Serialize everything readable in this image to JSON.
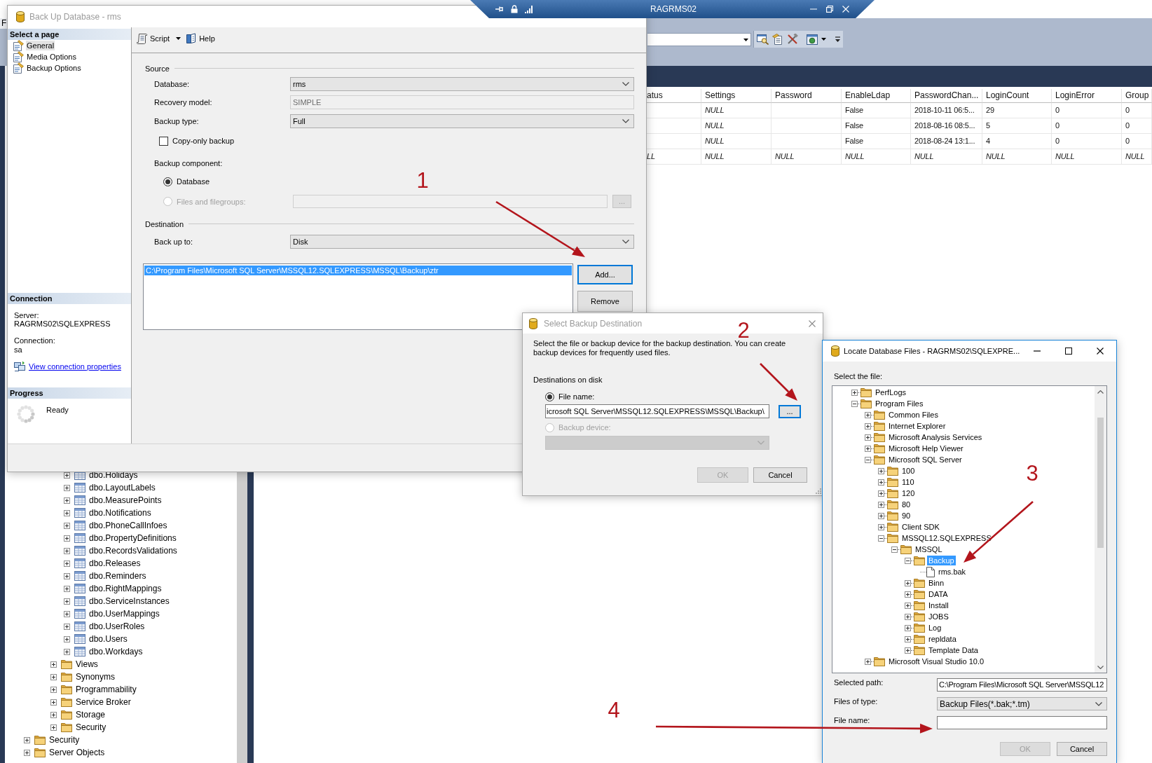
{
  "window_tab": {
    "title": "RAGRMS02"
  },
  "menu": [
    "F"
  ],
  "backup_dialog": {
    "title": "Back Up Database - rms",
    "active": false,
    "pages_header": "Select a page",
    "pages": [
      {
        "label": "General",
        "selected": true
      },
      {
        "label": "Media Options",
        "selected": false
      },
      {
        "label": "Backup Options",
        "selected": false
      }
    ],
    "toolbar": [
      {
        "label": "Script",
        "kind": "script"
      },
      {
        "label": "Help",
        "kind": "help"
      }
    ],
    "source": {
      "title": "Source",
      "fields": [
        {
          "label": "Database:",
          "value": "rms",
          "kind": "dropdown"
        },
        {
          "label": "Recovery model:",
          "value": "SIMPLE",
          "kind": "readonly"
        },
        {
          "label": "Backup type:",
          "value": "Full",
          "kind": "dropdown"
        }
      ],
      "copy_only": {
        "label": "Copy-only backup",
        "checked": false
      },
      "component_label": "Backup component:",
      "components": [
        {
          "label": "Database",
          "selected": true,
          "disabled": false,
          "kind": "radio"
        },
        {
          "label": "Files and filegroups:",
          "selected": false,
          "disabled": true,
          "kind": "field"
        }
      ],
      "browse_button": {
        "label": "...",
        "disabled": true
      }
    },
    "destination": {
      "title": "Destination",
      "fields": [
        {
          "label": "Back up to:",
          "value": "Disk",
          "kind": "dropdown"
        }
      ],
      "files": [
        {
          "path": "C:\\Program Files\\Microsoft SQL Server\\MSSQL12.SQLEXPRESS\\MSSQL\\Backup\\ztr",
          "selected": true
        }
      ],
      "buttons": [
        {
          "label": "Add...",
          "focused": true
        },
        {
          "label": "Remove",
          "focused": false
        }
      ]
    },
    "connection": {
      "header": "Connection",
      "server_label": "Server:",
      "server": "RAGRMS02\\SQLEXPRESS",
      "connection_label": "Connection:",
      "connection": "sa",
      "link": "View connection properties"
    },
    "progress": {
      "header": "Progress",
      "status": "Ready"
    }
  },
  "results_grid": {
    "columns": [
      "atus",
      "Settings",
      "Password",
      "EnableLdap",
      "PasswordChan...",
      "LoginCount",
      "LoginError",
      "Group"
    ],
    "rows": [
      {
        "cells": [
          null,
          {
            "text": "NULL",
            "kind": "null"
          },
          null,
          {
            "text": "False",
            "kind": "value"
          },
          {
            "text": "2018-10-11 06:5...",
            "kind": "value"
          },
          {
            "text": "29",
            "kind": "value"
          },
          {
            "text": "0",
            "kind": "value"
          },
          {
            "text": "0",
            "kind": "value"
          }
        ]
      },
      {
        "cells": [
          null,
          {
            "text": "NULL",
            "kind": "null"
          },
          null,
          {
            "text": "False",
            "kind": "value"
          },
          {
            "text": "2018-08-16 08:5...",
            "kind": "value"
          },
          {
            "text": "5",
            "kind": "value"
          },
          {
            "text": "0",
            "kind": "value"
          },
          {
            "text": "0",
            "kind": "value"
          }
        ]
      },
      {
        "cells": [
          null,
          {
            "text": "NULL",
            "kind": "null"
          },
          null,
          {
            "text": "False",
            "kind": "value"
          },
          {
            "text": "2018-08-24 13:1...",
            "kind": "value"
          },
          {
            "text": "4",
            "kind": "value"
          },
          {
            "text": "0",
            "kind": "value"
          },
          {
            "text": "0",
            "kind": "value"
          }
        ]
      },
      {
        "cells": [
          {
            "text": "LL",
            "kind": "null"
          },
          {
            "text": "NULL",
            "kind": "null"
          },
          {
            "text": "NULL",
            "kind": "null"
          },
          {
            "text": "NULL",
            "kind": "null"
          },
          {
            "text": "NULL",
            "kind": "null"
          },
          {
            "text": "NULL",
            "kind": "null"
          },
          {
            "text": "NULL",
            "kind": "null"
          },
          {
            "text": "NULL",
            "kind": "null"
          }
        ]
      }
    ]
  },
  "object_explorer": {
    "tree": [
      {
        "children": [
          {
            "children": [
              {
                "children": [
                  {
                    "label": "dbo.Holidays",
                    "kind": "table",
                    "expanded": false,
                    "selected": false
                  },
                  {
                    "label": "dbo.LayoutLabels",
                    "kind": "table",
                    "expanded": false,
                    "selected": false
                  },
                  {
                    "label": "dbo.MeasurePoints",
                    "kind": "table",
                    "expanded": false,
                    "selected": false
                  },
                  {
                    "label": "dbo.Notifications",
                    "kind": "table",
                    "expanded": false,
                    "selected": false
                  },
                  {
                    "label": "dbo.PhoneCallInfoes",
                    "kind": "table",
                    "expanded": false,
                    "selected": false
                  },
                  {
                    "label": "dbo.PropertyDefinitions",
                    "kind": "table",
                    "expanded": false,
                    "selected": false
                  },
                  {
                    "label": "dbo.RecordsValidations",
                    "kind": "table",
                    "expanded": false,
                    "selected": false
                  },
                  {
                    "label": "dbo.Releases",
                    "kind": "table",
                    "expanded": false,
                    "selected": false
                  },
                  {
                    "label": "dbo.Reminders",
                    "kind": "table",
                    "expanded": false,
                    "selected": false
                  },
                  {
                    "label": "dbo.RightMappings",
                    "kind": "table",
                    "expanded": false,
                    "selected": false
                  },
                  {
                    "label": "dbo.ServiceInstances",
                    "kind": "table",
                    "expanded": false,
                    "selected": false
                  },
                  {
                    "label": "dbo.UserMappings",
                    "kind": "table",
                    "expanded": false,
                    "selected": false
                  },
                  {
                    "label": "dbo.UserRoles",
                    "kind": "table",
                    "expanded": false,
                    "selected": false
                  },
                  {
                    "label": "dbo.Users",
                    "kind": "table",
                    "expanded": false,
                    "selected": false
                  },
                  {
                    "label": "dbo.Workdays",
                    "kind": "table",
                    "expanded": false,
                    "selected": false
                  }
                ]
              },
              {
                "label": "Views",
                "kind": "folder",
                "expanded": false,
                "selected": false
              },
              {
                "label": "Synonyms",
                "kind": "folder",
                "expanded": false,
                "selected": false
              },
              {
                "label": "Programmability",
                "kind": "folder",
                "expanded": false,
                "selected": false
              },
              {
                "label": "Service Broker",
                "kind": "folder",
                "expanded": false,
                "selected": false
              },
              {
                "label": "Storage",
                "kind": "folder",
                "expanded": false,
                "selected": false
              },
              {
                "label": "Security",
                "kind": "folder",
                "expanded": false,
                "selected": false
              }
            ]
          }
        ]
      },
      {
        "label": "Security",
        "kind": "folder",
        "expanded": false,
        "selected": false
      },
      {
        "label": "Server Objects",
        "kind": "folder",
        "expanded": false,
        "selected": false
      }
    ]
  },
  "select_destination_dialog": {
    "title": "Select Backup Destination",
    "active": false,
    "description": "Select the file or backup device for the backup destination. You can create backup devices for frequently used files.",
    "group_label": "Destinations on disk",
    "options": [
      {
        "label": "File name:",
        "selected": true,
        "disabled": false,
        "kind": "text",
        "value": "icrosoft SQL Server\\MSSQL12.SQLEXPRESS\\MSSQL\\Backup\\"
      },
      {
        "label": "Backup device:",
        "selected": false,
        "disabled": true,
        "kind": "dropdown"
      }
    ],
    "browse_button": {
      "label": "...",
      "focused": true
    },
    "buttons": [
      {
        "label": "OK",
        "disabled": true
      },
      {
        "label": "Cancel",
        "disabled": false
      }
    ]
  },
  "locate_dialog": {
    "title": "Locate Database Files - RAGRMS02\\SQLEXPRE...",
    "active": true,
    "tree_label": "Select the file:",
    "tree": [
      {
        "label": "PerfLogs",
        "kind": "folder",
        "expanded": false,
        "selected": false
      },
      {
        "label": "Program Files",
        "kind": "folder",
        "expanded": true,
        "selected": false,
        "children": [
          {
            "label": "Common Files",
            "kind": "folder",
            "expanded": false,
            "selected": false
          },
          {
            "label": "Internet Explorer",
            "kind": "folder",
            "expanded": false,
            "selected": false
          },
          {
            "label": "Microsoft Analysis Services",
            "kind": "folder",
            "expanded": false,
            "selected": false
          },
          {
            "label": "Microsoft Help Viewer",
            "kind": "folder",
            "expanded": false,
            "selected": false
          },
          {
            "label": "Microsoft SQL Server",
            "kind": "folder",
            "expanded": true,
            "selected": false,
            "children": [
              {
                "label": "100",
                "kind": "folder",
                "expanded": false,
                "selected": false
              },
              {
                "label": "110",
                "kind": "folder",
                "expanded": false,
                "selected": false
              },
              {
                "label": "120",
                "kind": "folder",
                "expanded": false,
                "selected": false
              },
              {
                "label": "80",
                "kind": "folder",
                "expanded": false,
                "selected": false
              },
              {
                "label": "90",
                "kind": "folder",
                "expanded": false,
                "selected": false
              },
              {
                "label": "Client SDK",
                "kind": "folder",
                "expanded": false,
                "selected": false
              },
              {
                "label": "MSSQL12.SQLEXPRESS",
                "kind": "folder",
                "expanded": true,
                "selected": false,
                "children": [
                  {
                    "label": "MSSQL",
                    "kind": "folder",
                    "expanded": true,
                    "selected": false,
                    "children": [
                      {
                        "label": "Backup",
                        "kind": "folder",
                        "expanded": true,
                        "selected": true,
                        "children": [
                          {
                            "label": "rms.bak",
                            "kind": "file",
                            "selected": false
                          }
                        ]
                      },
                      {
                        "label": "Binn",
                        "kind": "folder",
                        "expanded": false,
                        "selected": false
                      },
                      {
                        "label": "DATA",
                        "kind": "folder",
                        "expanded": false,
                        "selected": false
                      },
                      {
                        "label": "Install",
                        "kind": "folder",
                        "expanded": false,
                        "selected": false
                      },
                      {
                        "label": "JOBS",
                        "kind": "folder",
                        "expanded": false,
                        "selected": false
                      },
                      {
                        "label": "Log",
                        "kind": "folder",
                        "expanded": false,
                        "selected": false
                      },
                      {
                        "label": "repldata",
                        "kind": "folder",
                        "expanded": false,
                        "selected": false
                      },
                      {
                        "label": "Template Data",
                        "kind": "folder",
                        "expanded": false,
                        "selected": false
                      }
                    ]
                  }
                ]
              }
            ]
          },
          {
            "label": "Microsoft Visual Studio 10.0",
            "kind": "folder",
            "expanded": false,
            "selected": false
          }
        ]
      }
    ],
    "fields": [
      {
        "label": "Selected path:",
        "value": "C:\\Program Files\\Microsoft SQL Server\\MSSQL12",
        "kind": "text"
      },
      {
        "label": "Files of type:",
        "value": "Backup Files(*.bak;*.tm)",
        "kind": "dropdown"
      },
      {
        "label": "File name:",
        "kind": "text"
      }
    ],
    "buttons": [
      {
        "label": "OK",
        "disabled": true
      },
      {
        "label": "Cancel",
        "disabled": false
      }
    ]
  },
  "annotations": [
    {
      "label": "1"
    },
    {
      "label": "2"
    },
    {
      "label": "3"
    },
    {
      "label": "4"
    }
  ]
}
